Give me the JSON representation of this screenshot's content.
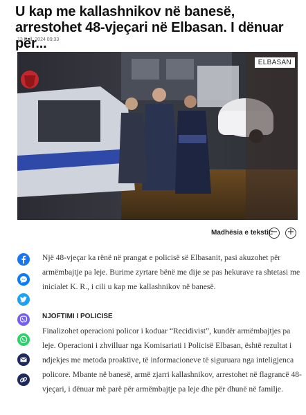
{
  "article": {
    "title": "U kap me kallashnikov në banesë, arrestohet 48-vjeçari në Elbasan. I dënuar për...",
    "date": "13 Prill, 2024 09:33",
    "image_badge": "ELBASAN",
    "text_size_label": "Madhësia e tekstit:",
    "decrease_symbol": "−",
    "increase_symbol": "+",
    "paragraph1": "Një 48-vjeçar ka rënë në prangat e policisë së Elbasanit, pasi akuzohet për armëmbajtje pa leje. Burime zyrtare bënë me dije se pas hekurave ra shtetasi me inicialet K. R., i cili u kap me kallashnikov në banesë.",
    "subheading": "NJOFTIMI I POLICISE",
    "paragraph2": "Finalizohet operacioni policor i koduar “Recidivist”, kundër armëmbajtjes pa leje. Operacioni i zhvilluar nga Komisariati i Policisë Elbasan, është rezultat i ndjekjes me metoda proaktive, të informacioneve të siguruara nga inteligjenca policore. Mbante në banesë, armë zjarri kallashnikov, arrestohet në flagrancë 48-vjeçari, i dënuar më parë për armëmbajtje pa leje dhe për dhunë në familje."
  },
  "share_icons": [
    {
      "name": "facebook-icon",
      "color": "#1877f2"
    },
    {
      "name": "messenger-icon",
      "color": "#0a7cff"
    },
    {
      "name": "twitter-icon",
      "color": "#1da1f2"
    },
    {
      "name": "viber-icon",
      "color": "#7360f2"
    },
    {
      "name": "whatsapp-icon",
      "color": "#25d366"
    },
    {
      "name": "email-icon",
      "color": "#1f2a5c"
    },
    {
      "name": "link-icon",
      "color": "#1f2a5c"
    }
  ]
}
